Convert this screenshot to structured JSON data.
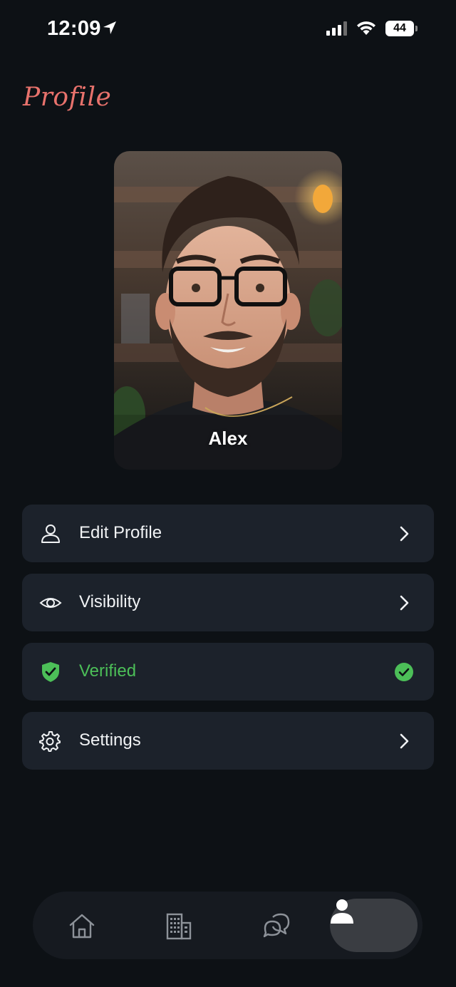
{
  "status_bar": {
    "time": "12:09",
    "battery_level": "44",
    "icons": [
      "location-arrow-icon",
      "cellular-signal-icon",
      "wifi-icon",
      "battery-icon"
    ]
  },
  "page": {
    "title": "Profile"
  },
  "profile": {
    "name": "Alex"
  },
  "menu": [
    {
      "label": "Edit Profile",
      "icon": "person-icon",
      "trailing": "chevron-right-icon"
    },
    {
      "label": "Visibility",
      "icon": "eye-icon",
      "trailing": "chevron-right-icon"
    },
    {
      "label": "Verified",
      "icon": "shield-check-icon",
      "trailing": "check-circle-icon"
    },
    {
      "label": "Settings",
      "icon": "gear-icon",
      "trailing": "chevron-right-icon"
    }
  ],
  "bottom_nav": [
    {
      "id": "home",
      "icon": "home-icon",
      "active": false
    },
    {
      "id": "buildings",
      "icon": "building-icon",
      "active": false
    },
    {
      "id": "messages",
      "icon": "chat-bubbles-icon",
      "active": false
    },
    {
      "id": "profile",
      "icon": "person-filled-icon",
      "active": true
    }
  ],
  "colors": {
    "background": "#0d1115",
    "card": "#1c222b",
    "title_accent": "#e8726c",
    "verified_green": "#4cbf58",
    "nav_active": "#3a3d42"
  }
}
